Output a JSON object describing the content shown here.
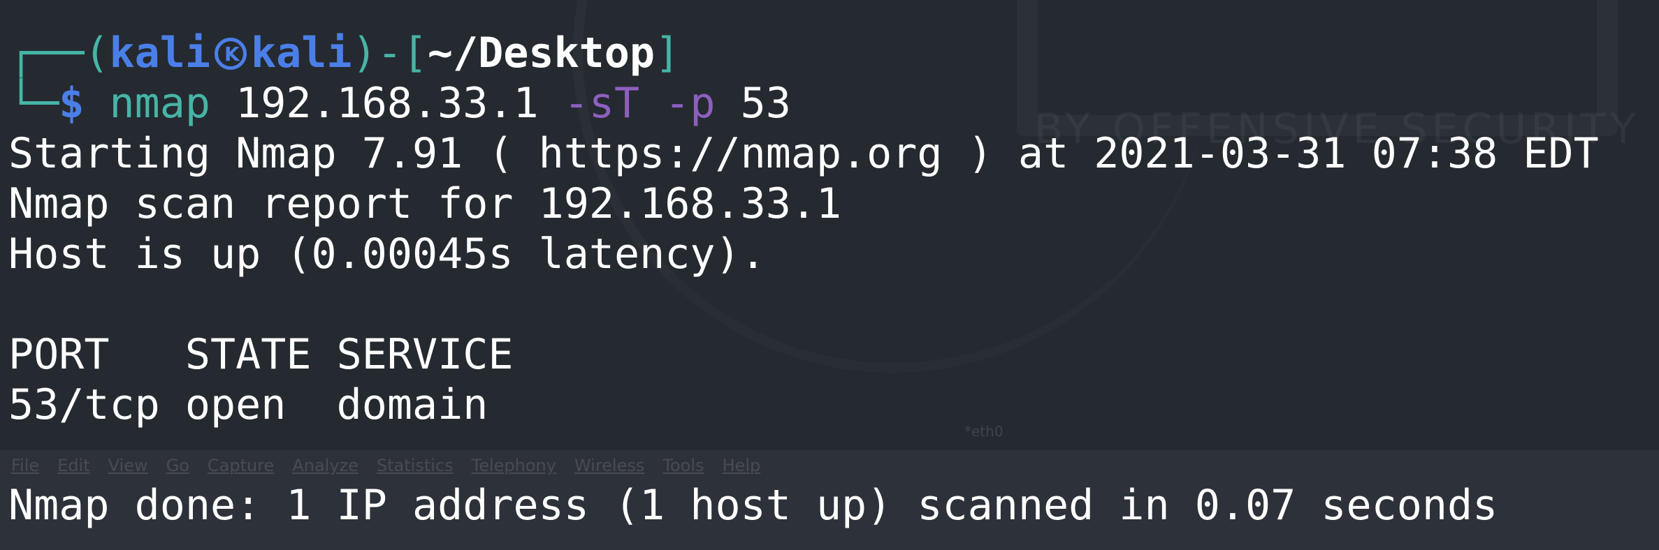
{
  "prompt": {
    "user": "kali",
    "host": "kali",
    "cwd": "~/Desktop",
    "symbol": "$",
    "command": {
      "program": "nmap",
      "target": "192.168.33.1",
      "flag1": "-sT",
      "flag2": "-p",
      "port": "53"
    }
  },
  "output": {
    "line1": "Starting Nmap 7.91 ( https://nmap.org ) at 2021-03-31 07:38 EDT",
    "line2": "Nmap scan report for 192.168.33.1",
    "line3": "Host is up (0.00045s latency).",
    "table_header": "PORT   STATE SERVICE",
    "table_rows": [
      "53/tcp open  domain"
    ],
    "done": "Nmap done: 1 IP address (1 host up) scanned in 0.07 seconds"
  },
  "colors": {
    "background": "#252a31",
    "prompt_frame": "#46b5a6",
    "user_host": "#4b7fe8",
    "flags": "#8e5fbf",
    "text": "#ffffff"
  }
}
